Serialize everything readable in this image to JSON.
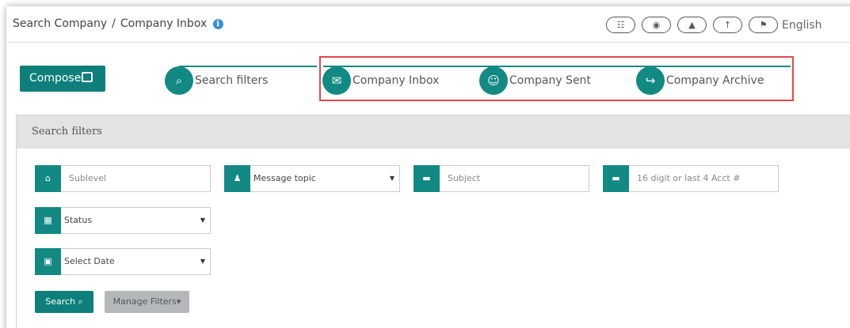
{
  "breadcrumb": {
    "part1": "Search Company",
    "separator": "/",
    "part2": "Company Inbox",
    "info": "i"
  },
  "top_icons": [
    {
      "icon": "list-icon",
      "glyph": "☷"
    },
    {
      "icon": "user-icon",
      "glyph": "◉"
    },
    {
      "icon": "bell-icon",
      "glyph": "▲"
    },
    {
      "icon": "upload-icon",
      "glyph": "↑"
    },
    {
      "icon": "flag-icon",
      "glyph": "⚑"
    }
  ],
  "language": "English",
  "compose": {
    "label": "Compose"
  },
  "steps": [
    {
      "label": "Search filters",
      "glyph": "⌕"
    },
    {
      "label": "Company Inbox",
      "glyph": "✉"
    },
    {
      "label": "Company Sent",
      "glyph": "☺"
    },
    {
      "label": "Company Archive",
      "glyph": "↪"
    }
  ],
  "panel": {
    "title": "Search filters"
  },
  "filters": {
    "sublevel": {
      "placeholder": "Sublevel",
      "glyph": "⌂"
    },
    "topic": {
      "value": "Message topic",
      "glyph": "♟"
    },
    "subject": {
      "placeholder": "Subject",
      "glyph": "▬"
    },
    "account": {
      "placeholder": "16 digit or last 4 Acct #",
      "glyph": "▬"
    },
    "status": {
      "value": "Status",
      "glyph": "▦"
    },
    "date": {
      "value": "Select Date",
      "glyph": "▣"
    },
    "caret": "▼"
  },
  "buttons": {
    "search": "Search",
    "search_glyph": "⌕",
    "manage": "Manage Filters",
    "manage_caret": "▾"
  },
  "colors": {
    "accent": "#128a83",
    "highlight": "#e24a4a"
  }
}
